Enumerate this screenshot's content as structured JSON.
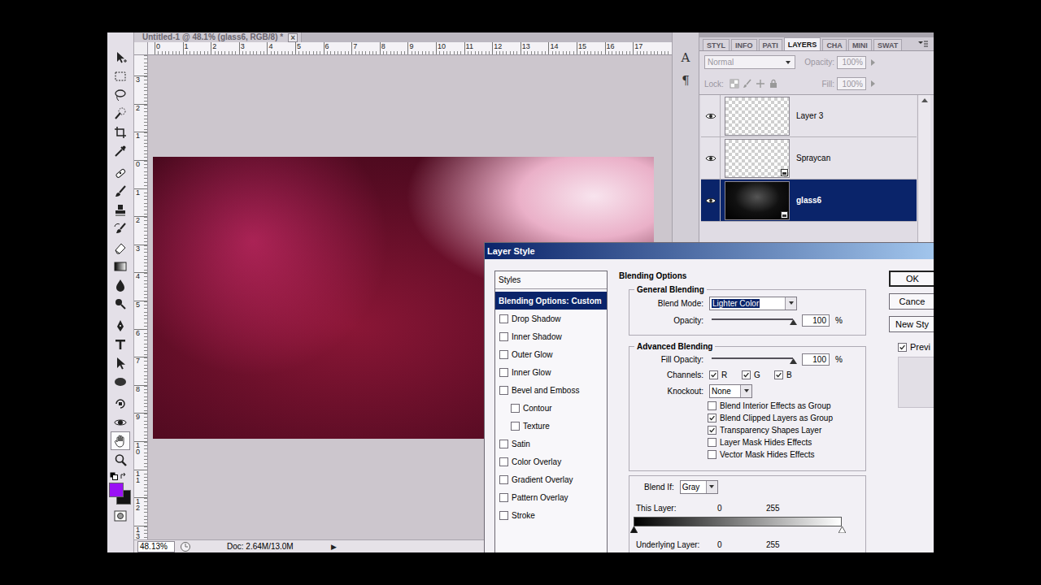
{
  "document": {
    "title": "Untitled-1 @ 48.1% (glass6, RGB/8) *",
    "close": "×"
  },
  "rulers": {
    "horizontal": [
      "0",
      "1",
      "2",
      "3",
      "4",
      "5",
      "6",
      "7",
      "8",
      "9",
      "10",
      "11",
      "12",
      "13",
      "14",
      "15",
      "16",
      "17"
    ],
    "vertical": [
      "3",
      "2",
      "1",
      "0",
      "1",
      "2",
      "3",
      "4",
      "5",
      "6",
      "7",
      "8",
      "9",
      "10",
      "11",
      "12",
      "13"
    ]
  },
  "toolbar": {
    "tools": [
      {
        "selected": false
      },
      {
        "selected": false
      },
      {
        "selected": false
      },
      {
        "selected": false
      },
      {
        "selected": false
      },
      {
        "selected": false
      },
      {
        "selected": false
      },
      {
        "selected": false
      },
      {
        "selected": false
      },
      {
        "selected": false
      },
      {
        "selected": false
      },
      {
        "selected": false
      },
      {
        "selected": false
      },
      {
        "selected": false
      },
      {
        "selected": false
      },
      {
        "selected": false
      },
      {
        "selected": false
      },
      {
        "selected": false
      },
      {
        "selected": false
      },
      {
        "selected": false
      },
      {
        "selected": true
      },
      {
        "selected": false
      }
    ],
    "swatches": [
      {
        "color": "#9a10f5"
      },
      {
        "color": "#141414"
      }
    ]
  },
  "status_bar": {
    "zoom": "48.13%",
    "doc": "Doc: 2.64M/13.0M",
    "arrow": "▶"
  },
  "dock": [
    {
      "icon": "A"
    },
    {
      "icon": "¶"
    }
  ],
  "panel": {
    "tabs": [
      {
        "label": "STYL",
        "selected": false
      },
      {
        "label": "INFO",
        "selected": false
      },
      {
        "label": "PATI",
        "selected": false
      },
      {
        "label": "LAYERS",
        "selected": true
      },
      {
        "label": "CHA",
        "selected": false
      },
      {
        "label": "MINI",
        "selected": false
      },
      {
        "label": "SWAT",
        "selected": false
      }
    ],
    "disabled": true,
    "blend_mode": "Normal",
    "opacity_label": "Opacity:",
    "opacity": "100%",
    "lock_label": "Lock:",
    "fill_label": "Fill:",
    "fill": "100%",
    "layers": [
      {
        "name": "Layer 3",
        "visible": true,
        "selected": false,
        "kind": "pixel"
      },
      {
        "name": "Spraycan",
        "visible": true,
        "selected": false,
        "kind": "smart"
      },
      {
        "name": "glass6",
        "visible": true,
        "selected": true,
        "kind": "smart"
      }
    ]
  },
  "dialog": {
    "title": "Layer Style",
    "styles_header": "Styles",
    "styles": [
      {
        "label": "Blending Options: Custom",
        "kind": "header",
        "selected": true
      },
      {
        "label": "Drop Shadow",
        "kind": "effect",
        "checked": false,
        "selected": false
      },
      {
        "label": "Inner Shadow",
        "kind": "effect",
        "checked": false,
        "selected": false
      },
      {
        "label": "Outer Glow",
        "kind": "effect",
        "checked": false,
        "selected": false
      },
      {
        "label": "Inner Glow",
        "kind": "effect",
        "checked": false,
        "selected": false
      },
      {
        "label": "Bevel and Emboss",
        "kind": "effect",
        "checked": false,
        "selected": false
      },
      {
        "label": "Contour",
        "kind": "sub",
        "checked": false,
        "selected": false
      },
      {
        "label": "Texture",
        "kind": "sub",
        "checked": false,
        "selected": false
      },
      {
        "label": "Satin",
        "kind": "effect",
        "checked": false,
        "selected": false
      },
      {
        "label": "Color Overlay",
        "kind": "effect",
        "checked": false,
        "selected": false
      },
      {
        "label": "Gradient Overlay",
        "kind": "effect",
        "checked": false,
        "selected": false
      },
      {
        "label": "Pattern Overlay",
        "kind": "effect",
        "checked": false,
        "selected": false
      },
      {
        "label": "Stroke",
        "kind": "effect",
        "checked": false,
        "selected": false
      }
    ],
    "section": "Blending Options",
    "general": {
      "title": "General Blending",
      "blend_mode_label": "Blend Mode:",
      "blend_mode": "Lighter Color",
      "blend_mode_highlighted": true,
      "opacity_label": "Opacity:",
      "opacity": "100",
      "opacity_level": 1,
      "unit": "%"
    },
    "advanced": {
      "title": "Advanced Blending",
      "fill_label": "Fill Opacity:",
      "fill": "100",
      "fill_level": 1,
      "unit": "%",
      "channels_label": "Channels:",
      "channels": [
        {
          "label": "R",
          "checked": true
        },
        {
          "label": "G",
          "checked": true
        },
        {
          "label": "B",
          "checked": true
        }
      ],
      "knockout_label": "Knockout:",
      "knockout": "None",
      "options": [
        {
          "label": "Blend Interior Effects as Group",
          "checked": false
        },
        {
          "label": "Blend Clipped Layers as Group",
          "checked": true
        },
        {
          "label": "Transparency Shapes Layer",
          "checked": true
        },
        {
          "label": "Layer Mask Hides Effects",
          "checked": false
        },
        {
          "label": "Vector Mask Hides Effects",
          "checked": false
        }
      ]
    },
    "blend_if": {
      "label": "Blend If:",
      "channel": "Gray",
      "this_layer": {
        "label": "This Layer:",
        "low": "0",
        "high": "255",
        "low_level": 0,
        "high_level": 1
      },
      "underlying": {
        "label": "Underlying Layer:",
        "low": "0",
        "high": "255"
      }
    },
    "buttons": [
      {
        "label": "OK",
        "default": true
      },
      {
        "label": "Cance",
        "default": false
      },
      {
        "label": "New Sty",
        "default": false
      }
    ],
    "preview": {
      "label": "Previ",
      "checked": true
    }
  }
}
